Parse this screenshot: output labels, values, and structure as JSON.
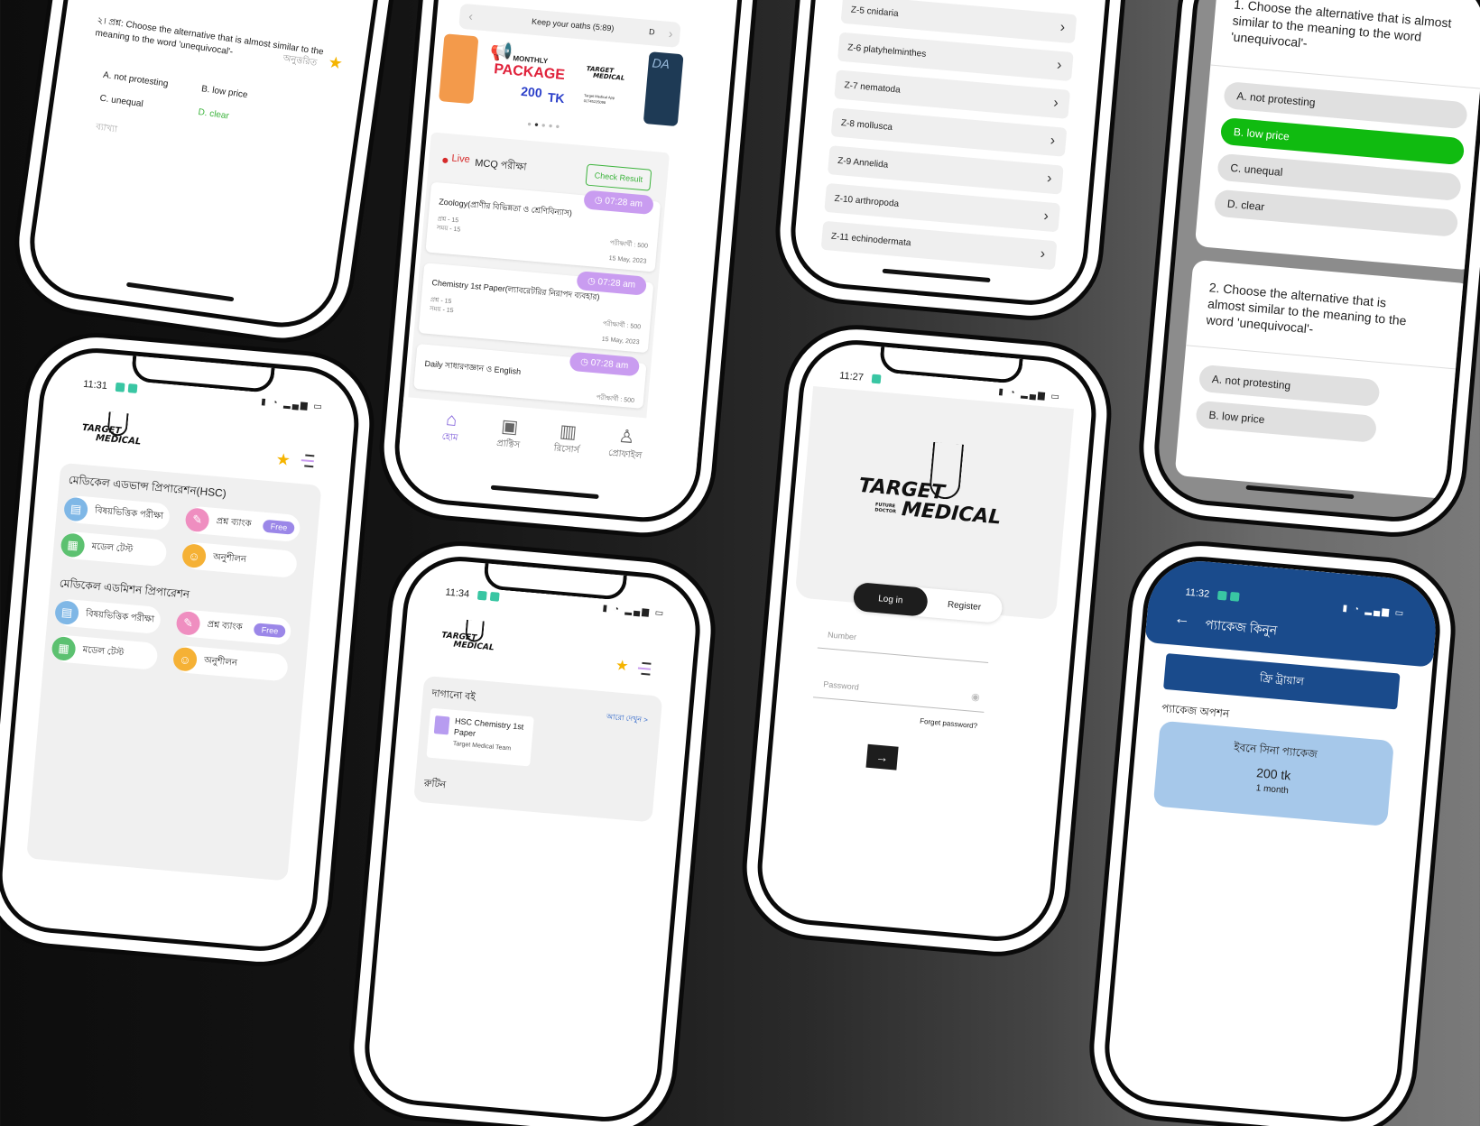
{
  "phone_q1": {
    "q_num": "২। প্রশ্ন:",
    "q_text": "Choose the alternative that is almost similar to the meaning to the word 'unequivocal'-",
    "tag": "অনুত্তরিত",
    "options": [
      "A. not protesting",
      "B. low price",
      "C. unequal",
      "D. clear"
    ],
    "explanation": "ব্যাখ্যা"
  },
  "phone_home1": {
    "time": "11:31",
    "logo_line1": "TARGET",
    "logo_line2": "MEDICAL",
    "section1_title": "মেডিকেল এডভান্স প্রিপারেশন(HSC)",
    "section1_items": [
      "বিষয়ভিত্তিক পরীক্ষা",
      "প্রশ্ন ব্যাংক",
      "মডেল টেস্ট",
      "অনুশীলন"
    ],
    "section2_title": "মেডিকেল এডমিশন প্রিপারেশন",
    "section2_items": [
      "বিষয়ভিত্তিক পরীক্ষা",
      "প্রশ্ন ব্যাংক",
      "মডেল টেস্ট",
      "অনুশীলন"
    ],
    "free_label": "Free",
    "colors": {
      "blue": "#7fb7e6",
      "pink": "#ef8ec0",
      "green": "#5cc170",
      "orange": "#f5b135",
      "star": "#f5b400"
    }
  },
  "phone_feed": {
    "banner_text": "Keep your oaths (5:89)",
    "banner_letter": "D",
    "promo_small": "MONTHLY",
    "promo_big": "PACKAGE",
    "promo_price": "200",
    "promo_unit": "TK",
    "promo_logo1": "TARGET",
    "promo_logo2": "MEDICAL",
    "promo_contact": "Target Medical App",
    "promo_phone": "01745225098",
    "side_letters": "DA",
    "live_label": "Live",
    "live_title": "MCQ পরীক্ষা",
    "check_result": "Check Result",
    "exams": [
      {
        "title": "Zoology(প্রাণীর বিভিন্নতা ও শ্রেণিবিন্যাস)",
        "time": "07:28 am",
        "q": "প্রশ্ন - 15",
        "t": "সময় - 15",
        "p": "পরীক্ষার্থী : 500",
        "date": "15 May, 2023"
      },
      {
        "title": "Chemistry 1st Paper(ল্যাবরেটরির নিরাপদ ব্যবহার)",
        "time": "07:28 am",
        "q": "প্রশ্ন - 15",
        "t": "সময় - 15",
        "p": "পরীক্ষার্থী : 500",
        "date": "15 May, 2023"
      },
      {
        "title": "Daily সাধারণজ্ঞান ও English",
        "time": "07:28 am",
        "p": "পরীক্ষার্থী : 500"
      }
    ],
    "nav": [
      "হোম",
      "প্রাক্টিস",
      "রিসোর্স",
      "প্রোফাইল"
    ]
  },
  "phone_list": {
    "items": [
      "Z-5 cnidaria",
      "Z-6 platyhelminthes",
      "Z-7 nematoda",
      "Z-8 mollusca",
      "Z-9 Annelida",
      "Z-10 arthropoda",
      "Z-11 echinodermata"
    ]
  },
  "phone_book": {
    "time": "11:34",
    "logo_line1": "TARGET",
    "logo_line2": "MEDICAL",
    "section": "দাগানো বই",
    "see_more": "আরো দেখুন >",
    "book_title": "HSC Chemistry 1st Paper",
    "book_author": "Target Medical Team",
    "routine": "রুটিন"
  },
  "phone_login": {
    "time": "11:27",
    "logo_line1": "TARGET",
    "logo_sub1": "FUTURE",
    "logo_sub2": "DOCTOR",
    "logo_line2": "MEDICAL",
    "tab_login": "Log in",
    "tab_register": "Register",
    "number_placeholder": "Number",
    "password_placeholder": "Password",
    "forgot": "Forget password?",
    "submit_arrow": "→"
  },
  "phone_quiz": {
    "q1_num": "1.",
    "q1_text": "Choose the alternative that is almost similar to the meaning to the word 'unequivocal'-",
    "q1_options": [
      "A. not protesting",
      "B. low price",
      "C. unequal",
      "D. clear"
    ],
    "q2_num": "2.",
    "q2_text": "Choose the alternative that is almost similar to the meaning to the word 'unequivocal'-",
    "q2_options": [
      "A. not protesting",
      "B. low price"
    ],
    "selected_color": "#10bb10"
  },
  "phone_package": {
    "time": "11:32",
    "header_title": "প্যাকেজ কিনুন",
    "free_trial": "ফ্রি ট্রায়াল",
    "options_label": "প্যাকেজ অপশন",
    "pkg_name": "ইবনে সিনা প্যাকেজ",
    "pkg_price": "200 tk",
    "pkg_duration": "1 month",
    "colors": {
      "header": "#1a4b8c",
      "card": "#a6c8ea"
    }
  }
}
